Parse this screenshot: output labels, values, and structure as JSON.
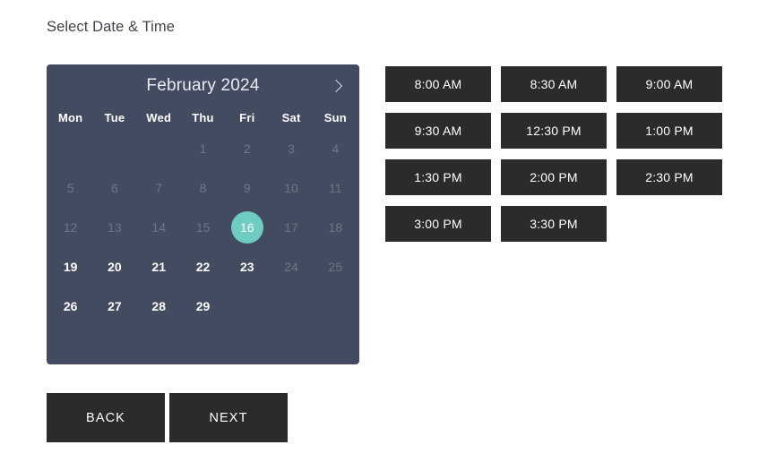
{
  "page": {
    "title": "Select Date & Time"
  },
  "calendar": {
    "month_label": "February 2024",
    "prev_label": "‹",
    "next_label": "›",
    "weekdays": [
      "Mon",
      "Tue",
      "Wed",
      "Thu",
      "Fri",
      "Sat",
      "Sun"
    ],
    "selected_day": "16",
    "accent_color": "#6ecdc0",
    "panel_color": "#424b60",
    "weeks": [
      [
        {
          "label": "",
          "state": "blank"
        },
        {
          "label": "",
          "state": "blank"
        },
        {
          "label": "",
          "state": "blank"
        },
        {
          "label": "1",
          "state": "disabled"
        },
        {
          "label": "2",
          "state": "disabled"
        },
        {
          "label": "3",
          "state": "disabled"
        },
        {
          "label": "4",
          "state": "disabled"
        }
      ],
      [
        {
          "label": "5",
          "state": "disabled"
        },
        {
          "label": "6",
          "state": "disabled"
        },
        {
          "label": "7",
          "state": "disabled"
        },
        {
          "label": "8",
          "state": "disabled"
        },
        {
          "label": "9",
          "state": "disabled"
        },
        {
          "label": "10",
          "state": "disabled"
        },
        {
          "label": "11",
          "state": "disabled"
        }
      ],
      [
        {
          "label": "12",
          "state": "disabled"
        },
        {
          "label": "13",
          "state": "disabled"
        },
        {
          "label": "14",
          "state": "disabled"
        },
        {
          "label": "15",
          "state": "disabled"
        },
        {
          "label": "16",
          "state": "selected"
        },
        {
          "label": "17",
          "state": "disabled"
        },
        {
          "label": "18",
          "state": "disabled"
        }
      ],
      [
        {
          "label": "19",
          "state": "enabled"
        },
        {
          "label": "20",
          "state": "enabled"
        },
        {
          "label": "21",
          "state": "enabled"
        },
        {
          "label": "22",
          "state": "enabled"
        },
        {
          "label": "23",
          "state": "enabled"
        },
        {
          "label": "24",
          "state": "disabled"
        },
        {
          "label": "25",
          "state": "disabled"
        }
      ],
      [
        {
          "label": "26",
          "state": "enabled"
        },
        {
          "label": "27",
          "state": "enabled"
        },
        {
          "label": "28",
          "state": "enabled"
        },
        {
          "label": "29",
          "state": "enabled"
        },
        {
          "label": "",
          "state": "blank"
        },
        {
          "label": "",
          "state": "blank"
        },
        {
          "label": "",
          "state": "blank"
        }
      ]
    ]
  },
  "time_slots": [
    "8:00 AM",
    "8:30 AM",
    "9:00 AM",
    "9:30 AM",
    "12:30 PM",
    "1:00 PM",
    "1:30 PM",
    "2:00 PM",
    "2:30 PM",
    "3:00 PM",
    "3:30 PM"
  ],
  "footer": {
    "back_label": "BACK",
    "next_label": "NEXT"
  }
}
